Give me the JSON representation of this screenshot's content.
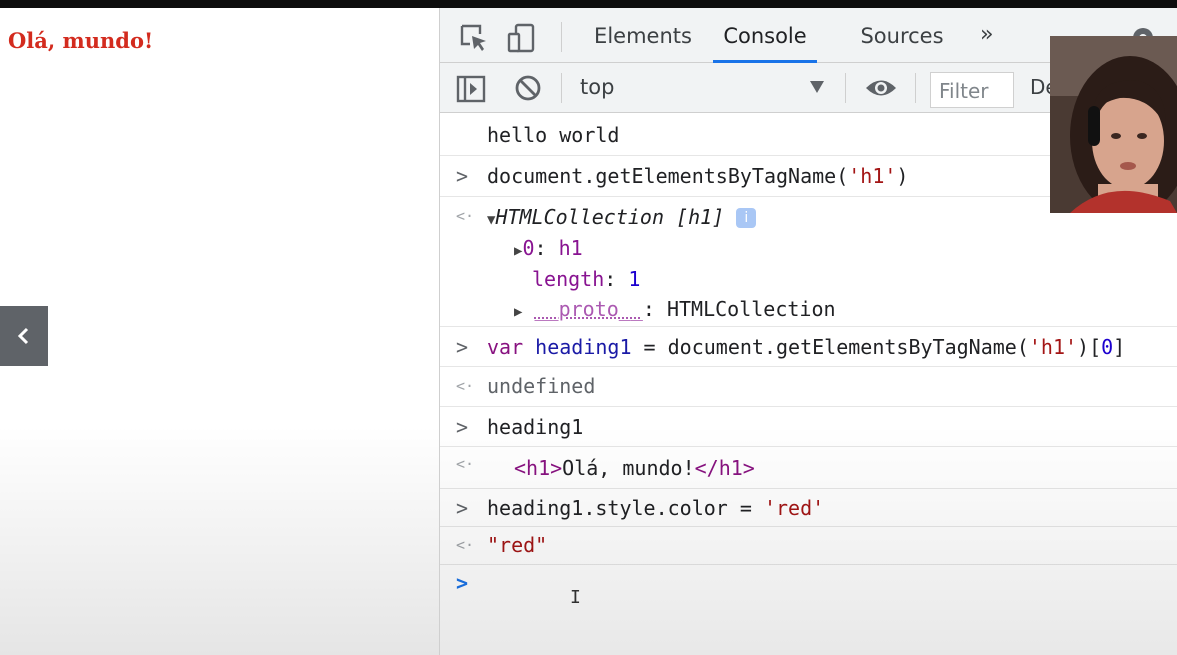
{
  "page": {
    "heading": "Olá, mundo!"
  },
  "devtools": {
    "tabs": [
      "Elements",
      "Console",
      "Sources"
    ],
    "active_tab": "Console",
    "toolbar": {
      "context": "top",
      "filter_placeholder": "Filter",
      "levels_label": "De"
    },
    "console": {
      "lines": {
        "hello": "hello world",
        "cmd1": "document.getElementsByTagName(",
        "cmd1_arg": "'h1'",
        "cmd1_end": ")",
        "coll_name": "HTMLCollection [h1]",
        "item0_key": "0",
        "item0_val": "h1",
        "length_key": "length",
        "length_val": "1",
        "proto_key": "__proto__",
        "proto_val": "HTMLCollection",
        "cmd2_kw": "var",
        "cmd2_var": "heading1",
        "cmd2_eq": " = document.getElementsByTagName(",
        "cmd2_arg": "'h1'",
        "cmd2_idx_open": ")[",
        "cmd2_idx": "0",
        "cmd2_idx_close": "]",
        "undef": "undefined",
        "cmd3": "heading1",
        "el_open": "<h1>",
        "el_text": "Olá, mundo!",
        "el_close": "</h1>",
        "cmd4": "heading1.style.color = ",
        "cmd4_arg": "'red'",
        "result4": "\"red\""
      }
    }
  },
  "icons": {
    "inspect": "inspect-element-icon",
    "device": "device-toolbar-icon",
    "sidebar": "console-sidebar-icon",
    "clear": "clear-console-icon",
    "eye": "live-expression-icon",
    "settings": "settings-gear-icon",
    "back": "chevron-left-icon"
  },
  "colors": {
    "heading": "#d32b1e",
    "active_tab_underline": "#1a73e8",
    "string": "#a31515"
  }
}
